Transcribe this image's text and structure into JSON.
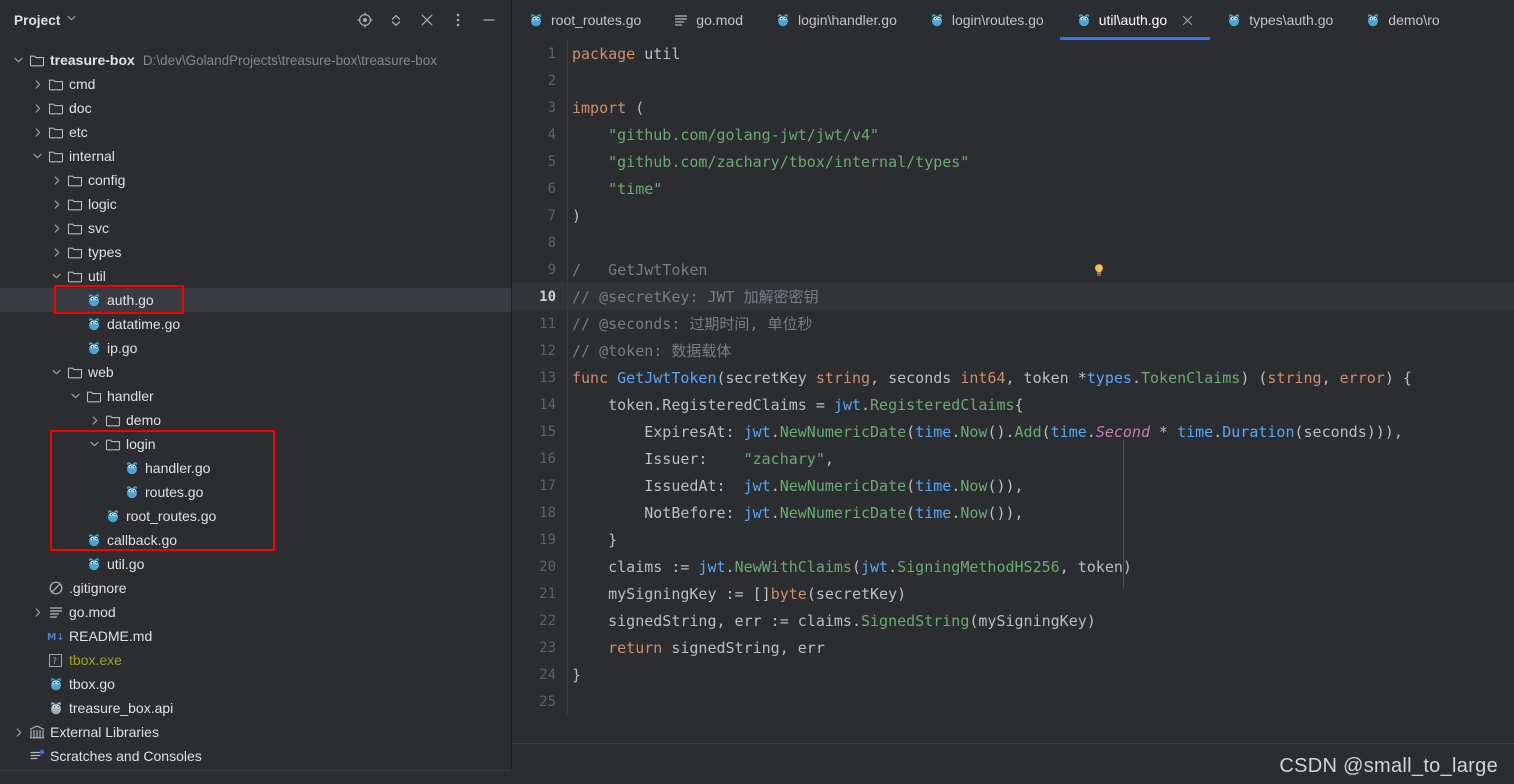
{
  "sidebar": {
    "title": "Project",
    "tools": [
      {
        "name": "select-opened-file-icon",
        "label": "Select Opened File"
      },
      {
        "name": "expand-collapse-icon",
        "label": "Expand / Collapse"
      },
      {
        "name": "collapse-all-icon",
        "label": "Collapse All"
      },
      {
        "name": "options-menu-icon",
        "label": "Options"
      },
      {
        "name": "hide-panel-icon",
        "label": "Hide"
      }
    ],
    "tree": [
      {
        "depth": 0,
        "arrow": "down",
        "icon": "folder-icon",
        "label": "treasure-box",
        "bold": true,
        "sub": "D:\\dev\\GolandProjects\\treasure-box\\treasure-box"
      },
      {
        "depth": 1,
        "arrow": "right",
        "icon": "folder-icon",
        "label": "cmd"
      },
      {
        "depth": 1,
        "arrow": "right",
        "icon": "folder-icon",
        "label": "doc"
      },
      {
        "depth": 1,
        "arrow": "right",
        "icon": "folder-icon",
        "label": "etc"
      },
      {
        "depth": 1,
        "arrow": "down",
        "icon": "folder-icon",
        "label": "internal"
      },
      {
        "depth": 2,
        "arrow": "right",
        "icon": "folder-icon",
        "label": "config"
      },
      {
        "depth": 2,
        "arrow": "right",
        "icon": "folder-icon",
        "label": "logic"
      },
      {
        "depth": 2,
        "arrow": "right",
        "icon": "folder-icon",
        "label": "svc"
      },
      {
        "depth": 2,
        "arrow": "right",
        "icon": "folder-icon",
        "label": "types"
      },
      {
        "depth": 2,
        "arrow": "down",
        "icon": "folder-icon",
        "label": "util"
      },
      {
        "depth": 3,
        "arrow": "none",
        "icon": "go-file-icon",
        "label": "auth.go",
        "selected": true
      },
      {
        "depth": 3,
        "arrow": "none",
        "icon": "go-file-icon",
        "label": "datatime.go"
      },
      {
        "depth": 3,
        "arrow": "none",
        "icon": "go-file-icon",
        "label": "ip.go"
      },
      {
        "depth": 2,
        "arrow": "down",
        "icon": "folder-icon",
        "label": "web"
      },
      {
        "depth": 3,
        "arrow": "down",
        "icon": "folder-icon",
        "label": "handler"
      },
      {
        "depth": 4,
        "arrow": "right",
        "icon": "folder-icon",
        "label": "demo"
      },
      {
        "depth": 4,
        "arrow": "down",
        "icon": "folder-icon",
        "label": "login"
      },
      {
        "depth": 5,
        "arrow": "none",
        "icon": "go-file-icon",
        "label": "handler.go"
      },
      {
        "depth": 5,
        "arrow": "none",
        "icon": "go-file-icon",
        "label": "routes.go"
      },
      {
        "depth": 4,
        "arrow": "none",
        "icon": "go-file-icon",
        "label": "root_routes.go"
      },
      {
        "depth": 3,
        "arrow": "none",
        "icon": "go-file-icon",
        "label": "callback.go"
      },
      {
        "depth": 3,
        "arrow": "none",
        "icon": "go-file-icon",
        "label": "util.go"
      },
      {
        "depth": 1,
        "arrow": "none",
        "icon": "gitignore-icon",
        "label": ".gitignore"
      },
      {
        "depth": 1,
        "arrow": "right",
        "icon": "gomod-icon",
        "label": "go.mod"
      },
      {
        "depth": 1,
        "arrow": "none",
        "icon": "markdown-icon",
        "label": "README.md"
      },
      {
        "depth": 1,
        "arrow": "none",
        "icon": "exe-icon",
        "label": "tbox.exe",
        "style": "yellowish"
      },
      {
        "depth": 1,
        "arrow": "none",
        "icon": "go-file-icon",
        "label": "tbox.go"
      },
      {
        "depth": 1,
        "arrow": "none",
        "icon": "api-file-icon",
        "label": "treasure_box.api"
      },
      {
        "depth": 0,
        "arrow": "right",
        "icon": "library-icon",
        "label": "External Libraries"
      },
      {
        "depth": 0,
        "arrow": "none",
        "icon": "scratches-icon",
        "label": "Scratches and Consoles"
      }
    ]
  },
  "tabs": [
    {
      "label": "root_routes.go",
      "icon": "go-file-icon",
      "active": false
    },
    {
      "label": "go.mod",
      "icon": "gomod-icon",
      "active": false
    },
    {
      "label": "login\\handler.go",
      "icon": "go-file-icon",
      "active": false
    },
    {
      "label": "login\\routes.go",
      "icon": "go-file-icon",
      "active": false
    },
    {
      "label": "util\\auth.go",
      "icon": "go-file-icon",
      "active": true,
      "closable": true
    },
    {
      "label": "types\\auth.go",
      "icon": "go-file-icon",
      "active": false
    },
    {
      "label": "demo\\ro",
      "icon": "go-file-icon",
      "active": false
    }
  ],
  "editor": {
    "current_line": 10,
    "lines": [
      {
        "n": 1,
        "tokens": [
          {
            "t": "package ",
            "c": "kw"
          },
          {
            "t": "util",
            "c": "typ"
          }
        ]
      },
      {
        "n": 2,
        "tokens": []
      },
      {
        "n": 3,
        "tokens": [
          {
            "t": "import",
            "c": "kw"
          },
          {
            "t": " (",
            "c": "typ"
          }
        ]
      },
      {
        "n": 4,
        "tokens": [
          {
            "t": "    \"github.com/golang-jwt/jwt/v4\"",
            "c": "str"
          }
        ]
      },
      {
        "n": 5,
        "tokens": [
          {
            "t": "    \"github.com/zachary/tbox/internal/types\"",
            "c": "str"
          }
        ]
      },
      {
        "n": 6,
        "tokens": [
          {
            "t": "    \"time\"",
            "c": "str"
          }
        ]
      },
      {
        "n": 7,
        "tokens": [
          {
            "t": ")",
            "c": "typ"
          }
        ]
      },
      {
        "n": 8,
        "tokens": []
      },
      {
        "n": 9,
        "tokens": [
          {
            "t": "/",
            "c": "cmt"
          },
          {
            "t": "   GetJwtToken",
            "c": "cmt"
          }
        ],
        "bulb": true
      },
      {
        "n": 10,
        "tokens": [
          {
            "t": "// @secretKey: JWT 加解密密钥",
            "c": "cmt"
          }
        ]
      },
      {
        "n": 11,
        "tokens": [
          {
            "t": "// @seconds: 过期时间, 单位秒",
            "c": "cmt"
          }
        ]
      },
      {
        "n": 12,
        "tokens": [
          {
            "t": "// @token: 数据载体",
            "c": "cmt"
          }
        ]
      },
      {
        "n": 13,
        "tokens": [
          {
            "t": "func ",
            "c": "kw"
          },
          {
            "t": "GetJwtToken",
            "c": "fn"
          },
          {
            "t": "(secretKey ",
            "c": "typ"
          },
          {
            "t": "string",
            "c": "kw"
          },
          {
            "t": ", seconds ",
            "c": "typ"
          },
          {
            "t": "int64",
            "c": "kw"
          },
          {
            "t": ", token *",
            "c": "typ"
          },
          {
            "t": "types",
            "c": "cyan"
          },
          {
            "t": ".",
            "c": "typ"
          },
          {
            "t": "TokenClaims",
            "c": "grn"
          },
          {
            "t": ") (",
            "c": "typ"
          },
          {
            "t": "string",
            "c": "kw"
          },
          {
            "t": ", ",
            "c": "typ"
          },
          {
            "t": "error",
            "c": "kw"
          },
          {
            "t": ") {",
            "c": "typ"
          }
        ]
      },
      {
        "n": 14,
        "tokens": [
          {
            "t": "    token.RegisteredClaims = ",
            "c": "typ"
          },
          {
            "t": "jwt",
            "c": "cyan"
          },
          {
            "t": ".",
            "c": "typ"
          },
          {
            "t": "RegisteredClaims",
            "c": "grn"
          },
          {
            "t": "{",
            "c": "typ"
          }
        ]
      },
      {
        "n": 15,
        "tokens": [
          {
            "t": "        ExpiresAt: ",
            "c": "typ"
          },
          {
            "t": "jwt",
            "c": "cyan"
          },
          {
            "t": ".",
            "c": "typ"
          },
          {
            "t": "NewNumericDate",
            "c": "grn"
          },
          {
            "t": "(",
            "c": "typ"
          },
          {
            "t": "time",
            "c": "cyan"
          },
          {
            "t": ".",
            "c": "typ"
          },
          {
            "t": "Now",
            "c": "grn"
          },
          {
            "t": "().",
            "c": "typ"
          },
          {
            "t": "Add",
            "c": "grn"
          },
          {
            "t": "(",
            "c": "typ"
          },
          {
            "t": "time",
            "c": "cyan"
          },
          {
            "t": ".",
            "c": "typ"
          },
          {
            "t": "Second",
            "c": "cnst"
          },
          {
            "t": " * ",
            "c": "typ"
          },
          {
            "t": "time",
            "c": "cyan"
          },
          {
            "t": ".",
            "c": "typ"
          },
          {
            "t": "Duration",
            "c": "cyan"
          },
          {
            "t": "(seconds))),",
            "c": "typ"
          }
        ]
      },
      {
        "n": 16,
        "tokens": [
          {
            "t": "        Issuer:    ",
            "c": "typ"
          },
          {
            "t": "\"zachary\"",
            "c": "str"
          },
          {
            "t": ",",
            "c": "typ"
          }
        ]
      },
      {
        "n": 17,
        "tokens": [
          {
            "t": "        IssuedAt:  ",
            "c": "typ"
          },
          {
            "t": "jwt",
            "c": "cyan"
          },
          {
            "t": ".",
            "c": "typ"
          },
          {
            "t": "NewNumericDate",
            "c": "grn"
          },
          {
            "t": "(",
            "c": "typ"
          },
          {
            "t": "time",
            "c": "cyan"
          },
          {
            "t": ".",
            "c": "typ"
          },
          {
            "t": "Now",
            "c": "grn"
          },
          {
            "t": "()),",
            "c": "typ"
          }
        ]
      },
      {
        "n": 18,
        "tokens": [
          {
            "t": "        NotBefore: ",
            "c": "typ"
          },
          {
            "t": "jwt",
            "c": "cyan"
          },
          {
            "t": ".",
            "c": "typ"
          },
          {
            "t": "NewNumericDate",
            "c": "grn"
          },
          {
            "t": "(",
            "c": "typ"
          },
          {
            "t": "time",
            "c": "cyan"
          },
          {
            "t": ".",
            "c": "typ"
          },
          {
            "t": "Now",
            "c": "grn"
          },
          {
            "t": "()),",
            "c": "typ"
          }
        ]
      },
      {
        "n": 19,
        "tokens": [
          {
            "t": "    }",
            "c": "typ"
          }
        ]
      },
      {
        "n": 20,
        "tokens": [
          {
            "t": "    claims := ",
            "c": "typ"
          },
          {
            "t": "jwt",
            "c": "cyan"
          },
          {
            "t": ".",
            "c": "typ"
          },
          {
            "t": "NewWithClaims",
            "c": "grn"
          },
          {
            "t": "(",
            "c": "typ"
          },
          {
            "t": "jwt",
            "c": "cyan"
          },
          {
            "t": ".",
            "c": "typ"
          },
          {
            "t": "SigningMethodHS256",
            "c": "grn"
          },
          {
            "t": ", token)",
            "c": "typ"
          }
        ]
      },
      {
        "n": 21,
        "tokens": [
          {
            "t": "    mySigningKey := []",
            "c": "typ"
          },
          {
            "t": "byte",
            "c": "kw"
          },
          {
            "t": "(secretKey)",
            "c": "typ"
          }
        ]
      },
      {
        "n": 22,
        "tokens": [
          {
            "t": "    signedString, err := claims.",
            "c": "typ"
          },
          {
            "t": "SignedString",
            "c": "grn"
          },
          {
            "t": "(mySigningKey)",
            "c": "typ"
          }
        ]
      },
      {
        "n": 23,
        "tokens": [
          {
            "t": "    return",
            "c": "kw"
          },
          {
            "t": " signedString, err",
            "c": "typ"
          }
        ]
      },
      {
        "n": 24,
        "tokens": [
          {
            "t": "}",
            "c": "typ"
          }
        ]
      },
      {
        "n": 25,
        "tokens": []
      }
    ]
  },
  "watermark": "CSDN @small_to_large",
  "colors": {
    "accent": "#3574f0",
    "panel_bg": "#2b2d30",
    "window_bg": "#1e1f22",
    "annotation_red": "#f80000",
    "selection": "#393b40"
  }
}
